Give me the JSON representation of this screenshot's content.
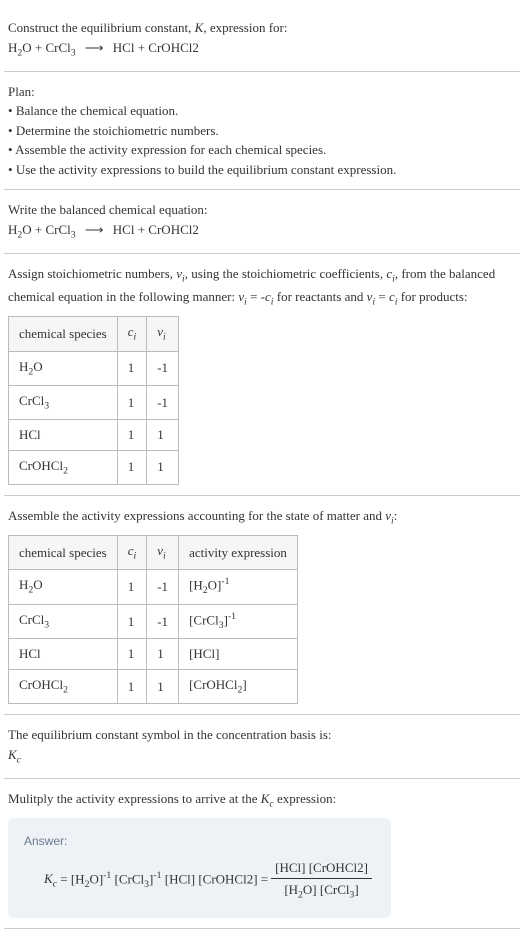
{
  "intro": {
    "line1": "Construct the equilibrium constant, K, expression for:",
    "equation": "H₂O + CrCl₃  ⟶  HCl + CrOHCl2"
  },
  "plan": {
    "heading": "Plan:",
    "items": [
      "Balance the chemical equation.",
      "Determine the stoichiometric numbers.",
      "Assemble the activity expression for each chemical species.",
      "Use the activity expressions to build the equilibrium constant expression."
    ]
  },
  "balanced": {
    "heading": "Write the balanced chemical equation:",
    "equation": "H₂O + CrCl₃  ⟶  HCl + CrOHCl2"
  },
  "stoich": {
    "text1": "Assign stoichiometric numbers, νᵢ, using the stoichiometric coefficients, cᵢ, from the balanced chemical equation in the following manner: νᵢ = -cᵢ for reactants and νᵢ = cᵢ for products:",
    "headers": [
      "chemical species",
      "cᵢ",
      "νᵢ"
    ],
    "rows": [
      {
        "species": "H₂O",
        "c": "1",
        "v": "-1"
      },
      {
        "species": "CrCl₃",
        "c": "1",
        "v": "-1"
      },
      {
        "species": "HCl",
        "c": "1",
        "v": "1"
      },
      {
        "species": "CrOHCl₂",
        "c": "1",
        "v": "1"
      }
    ]
  },
  "activity": {
    "text1": "Assemble the activity expressions accounting for the state of matter and νᵢ:",
    "headers": [
      "chemical species",
      "cᵢ",
      "νᵢ",
      "activity expression"
    ],
    "rows": [
      {
        "species": "H₂O",
        "c": "1",
        "v": "-1",
        "expr": "[H₂O]⁻¹"
      },
      {
        "species": "CrCl₃",
        "c": "1",
        "v": "-1",
        "expr": "[CrCl₃]⁻¹"
      },
      {
        "species": "HCl",
        "c": "1",
        "v": "1",
        "expr": "[HCl]"
      },
      {
        "species": "CrOHCl₂",
        "c": "1",
        "v": "1",
        "expr": "[CrOHCl₂]"
      }
    ]
  },
  "symbol": {
    "text": "The equilibrium constant symbol in the concentration basis is:",
    "sym": "K𝒸"
  },
  "multiply": {
    "text": "Mulitply the activity expressions to arrive at the K𝒸 expression:"
  },
  "answer": {
    "label": "Answer:",
    "lhs": "K𝒸 = [H₂O]⁻¹ [CrCl₃]⁻¹ [HCl] [CrOHCl2] = ",
    "num": "[HCl] [CrOHCl2]",
    "den": "[H₂O] [CrCl₃]"
  }
}
